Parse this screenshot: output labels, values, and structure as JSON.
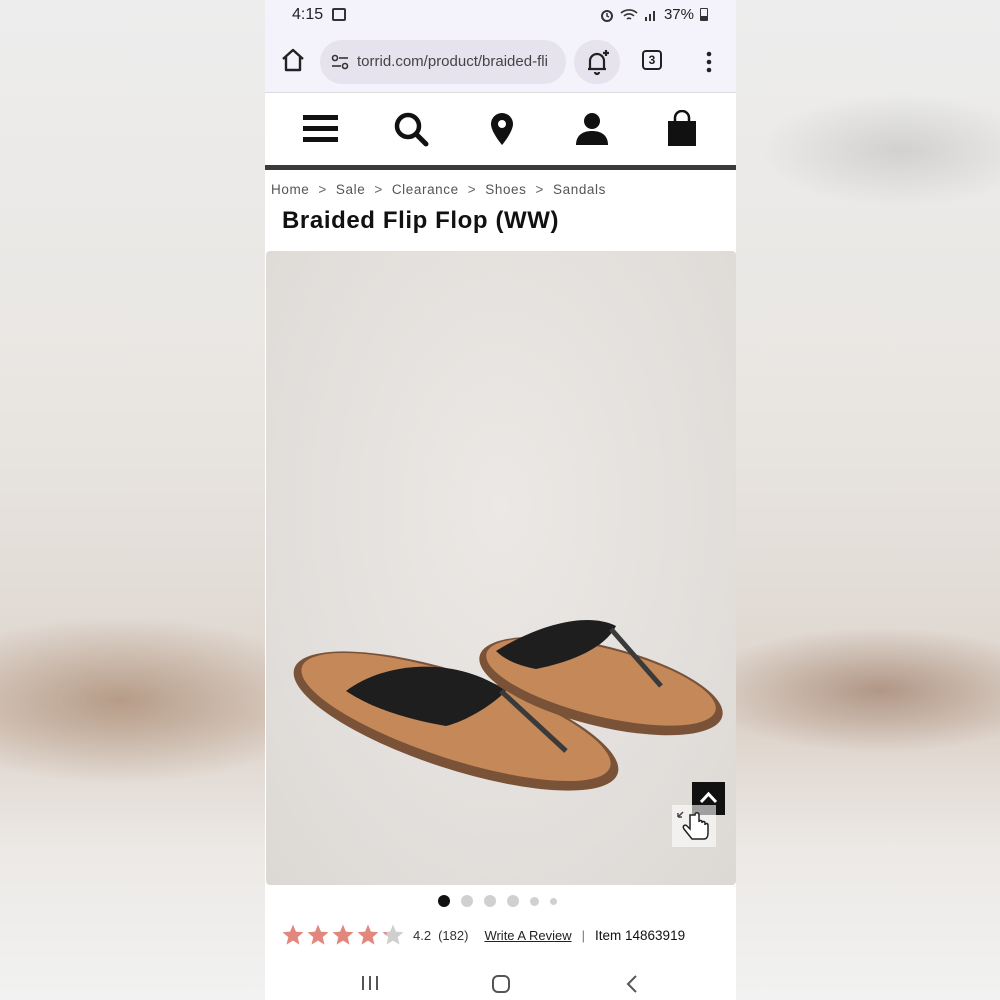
{
  "status_bar": {
    "time": "4:15",
    "battery": "37%",
    "icons": [
      "image-icon",
      "alarm-icon",
      "wifi-icon",
      "signal-icon",
      "battery-icon"
    ]
  },
  "browser": {
    "url": "torrid.com/product/braided-fli",
    "tab_count": "3",
    "icons": [
      "home-icon",
      "site-settings-icon",
      "notification-add-icon",
      "tabs-icon",
      "more-menu-icon"
    ]
  },
  "site_nav": {
    "icons": [
      "menu-icon",
      "search-icon",
      "location-pin-icon",
      "account-icon",
      "shopping-bag-icon"
    ]
  },
  "breadcrumb": [
    "Home",
    "Sale",
    "Clearance",
    "Shoes",
    "Sandals"
  ],
  "breadcrumb_separator": ">",
  "product": {
    "title": "Braided Flip Flop (WW)",
    "image_count": 6,
    "active_image": 1,
    "rating": "4.2",
    "rating_value": 4.2,
    "rating_max": 5,
    "review_count": "(182)",
    "write_review": "Write A Review",
    "separator": "|",
    "item_number": "Item 14863919"
  },
  "colors": {
    "star": "#e2877e",
    "star_empty": "#cfcfcf",
    "header_bar": "#3a3a3a",
    "chrome_bg": "#f4f2fa"
  }
}
